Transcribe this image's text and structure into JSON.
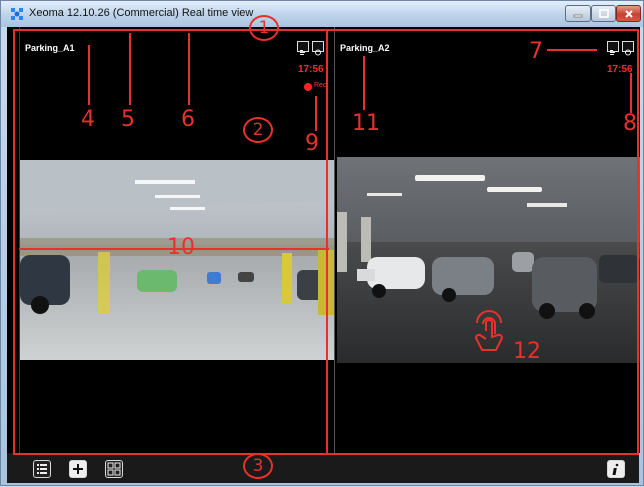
{
  "window": {
    "title": "Xeoma 12.10.26 (Commercial) Real time view",
    "minimize_icon": "minimize-icon",
    "maximize_icon": "maximize-icon",
    "close_icon": "close-icon"
  },
  "cameras": [
    {
      "name": "Parking_A1",
      "time": "17:56",
      "rec_label": "Rec"
    },
    {
      "name": "Parking_A2",
      "time": "17:56"
    }
  ],
  "toolbar": {
    "buttons": [
      "list-icon",
      "add-icon",
      "grid-layout-icon"
    ],
    "right_button": "info-icon"
  },
  "annotations": [
    "1",
    "2",
    "3",
    "4",
    "5",
    "6",
    "7",
    "8",
    "9",
    "10",
    "11",
    "12"
  ],
  "colors": {
    "annotation": "#e8312c",
    "time": "#ff2a2a",
    "rec": "#ff2222"
  }
}
